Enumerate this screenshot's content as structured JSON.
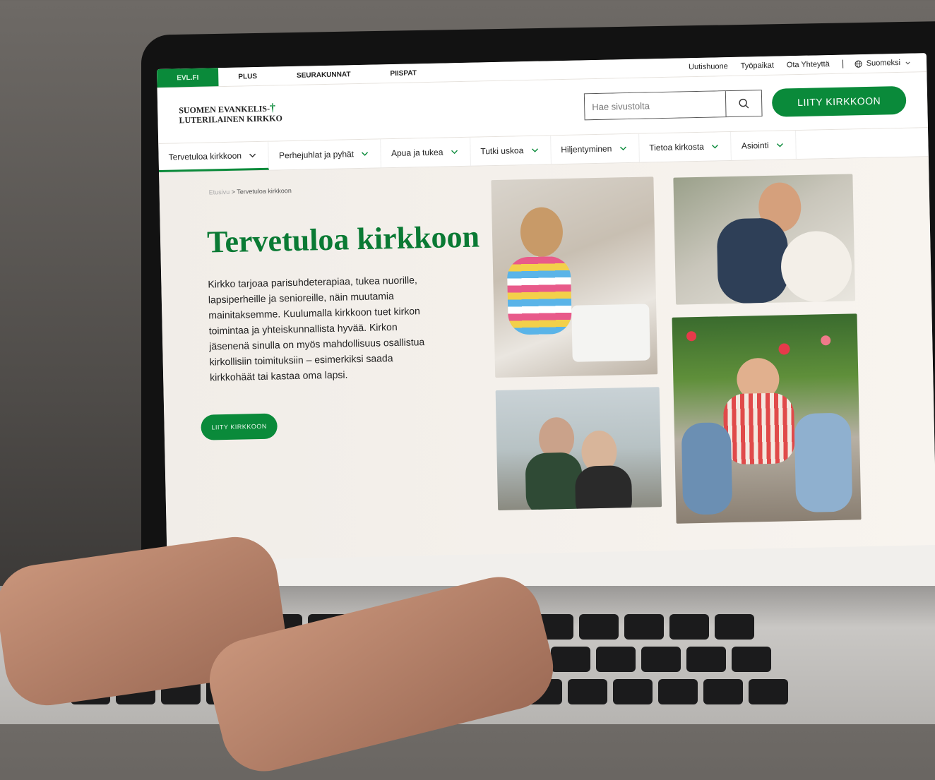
{
  "topbar": {
    "site_tabs": [
      "EVL.FI",
      "PLUS",
      "SEURAKUNNAT",
      "PIISPAT"
    ],
    "links": [
      "Uutishuone",
      "Työpaikat",
      "Ota Yhteyttä"
    ],
    "language": "Suomeksi"
  },
  "header": {
    "logo_line1": "SUOMEN EVANKELIS-",
    "logo_line2": "LUTERILAINEN KIRKKO",
    "search_placeholder": "Hae sivustolta",
    "join_button": "LIITY KIRKKOON"
  },
  "nav": {
    "items": [
      {
        "label": "Tervetuloa kirkkoon"
      },
      {
        "label": "Perhejuhlat ja pyhät"
      },
      {
        "label": "Apua ja tukea"
      },
      {
        "label": "Tutki uskoa"
      },
      {
        "label": "Hiljentyminen"
      },
      {
        "label": "Tietoa kirkosta"
      },
      {
        "label": "Asiointi"
      }
    ]
  },
  "hero": {
    "breadcrumb_home": "Etusivu",
    "breadcrumb_sep": ">",
    "breadcrumb_current": "Tervetuloa kirkkoon",
    "title": "Tervetuloa kirkkoon",
    "body": "Kirkko tarjoaa parisuhdeterapiaa, tukea nuorille, lapsiperheille ja senioreille, näin muutamia mainitaksemme. Kuulumalla kirkkoon tuet kirkon toimintaa ja yhteiskunnallista hyvää. Kirkon jäsenenä sinulla on myös mahdollisuus osallistua kirkollisiin toimituksiin – esimerkiksi saada kirkkohäät tai kastaa oma lapsi.",
    "cta": "LIITY KIRKKOON"
  },
  "colors": {
    "brand_green": "#0a8a3a",
    "title_green": "#0a7a34"
  }
}
